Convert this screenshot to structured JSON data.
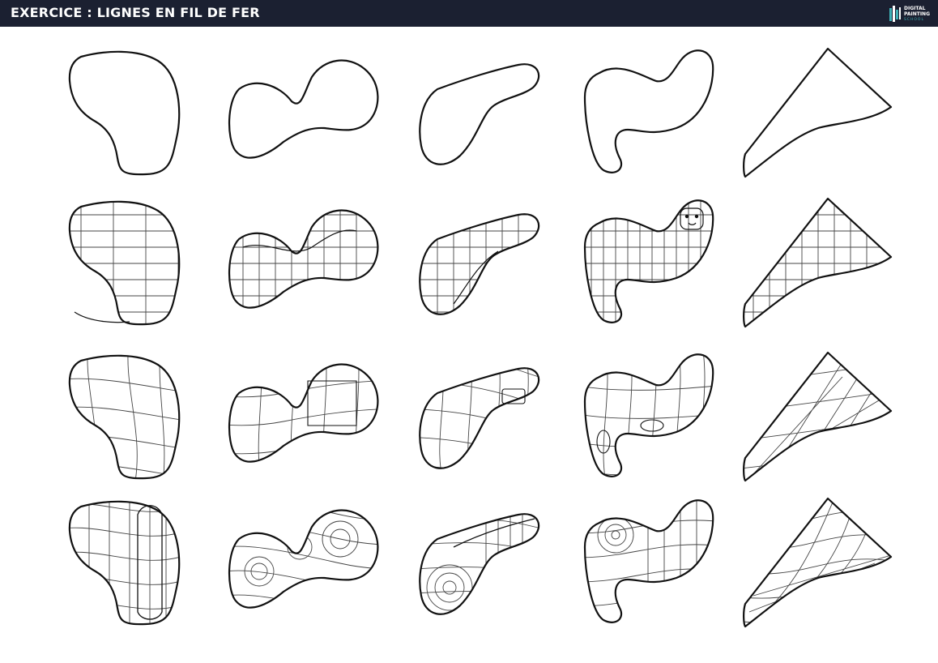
{
  "header": {
    "title": "EXERCICE : LIGNES EN FIL DE FER",
    "logo": {
      "icon": "digital-painting-school-logo-icon",
      "line1": "DIGITAL",
      "line2": "PAINTING",
      "line3": "SCHOOL",
      "accent": "#3fb1b6"
    },
    "background": "#1b2031"
  },
  "grid": {
    "columns": 5,
    "rows": 4,
    "shapes": [
      "blob",
      "peanut",
      "bean",
      "s-curve",
      "triangle"
    ],
    "row_styles": [
      "outline",
      "wireframe-mechanical",
      "wireframe-surface",
      "wireframe-organic"
    ]
  }
}
